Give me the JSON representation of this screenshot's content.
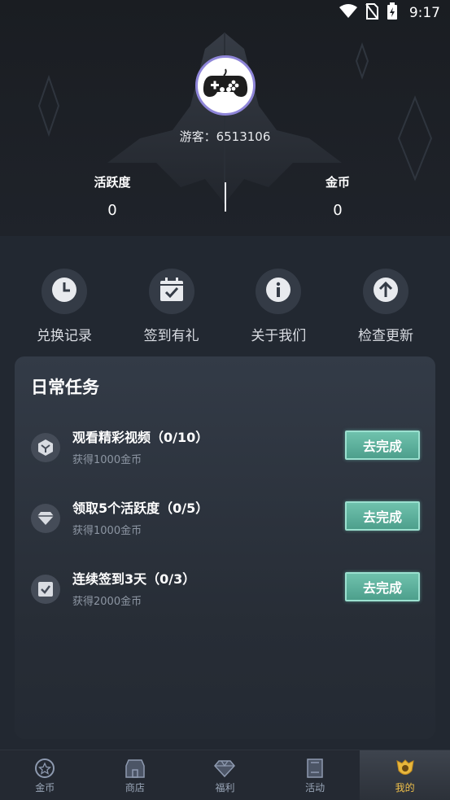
{
  "status_bar": {
    "time": "9:17",
    "icons": [
      "wifi-icon",
      "no-sim-icon",
      "battery-charging-icon"
    ]
  },
  "profile": {
    "avatar_icon": "gamepad-icon",
    "username": "游客：6513106",
    "activity_label": "活跃度",
    "activity_value": "0",
    "coins_label": "金币",
    "coins_value": "0"
  },
  "actions": [
    {
      "label": "兑换记录",
      "icon": "clock-icon"
    },
    {
      "label": "签到有礼",
      "icon": "calendar-check-icon"
    },
    {
      "label": "关于我们",
      "icon": "info-icon"
    },
    {
      "label": "检查更新",
      "icon": "upload-arrow-icon"
    }
  ],
  "daily_tasks": {
    "title": "日常任务",
    "tasks": [
      {
        "title": "观看精彩视频（0/10）",
        "reward": "获得1000金币",
        "button": "去完成",
        "icon": "cube-icon"
      },
      {
        "title": "领取5个活跃度（0/5）",
        "reward": "获得1000金币",
        "button": "去完成",
        "icon": "diamond-icon"
      },
      {
        "title": "连续签到3天（0/3）",
        "reward": "获得2000金币",
        "button": "去完成",
        "icon": "checkbox-icon"
      }
    ]
  },
  "bottom_nav": {
    "items": [
      {
        "label": "金币",
        "icon": "coin-icon",
        "active": false
      },
      {
        "label": "商店",
        "icon": "shop-icon",
        "active": false
      },
      {
        "label": "福利",
        "icon": "gem-icon",
        "active": false
      },
      {
        "label": "活动",
        "icon": "bookmark-icon",
        "active": false
      },
      {
        "label": "我的",
        "icon": "profile-badge-icon",
        "active": true
      }
    ]
  },
  "colors": {
    "background": "#222831",
    "button_teal": "#5fb29e",
    "active_tab": "#f0c04a"
  }
}
